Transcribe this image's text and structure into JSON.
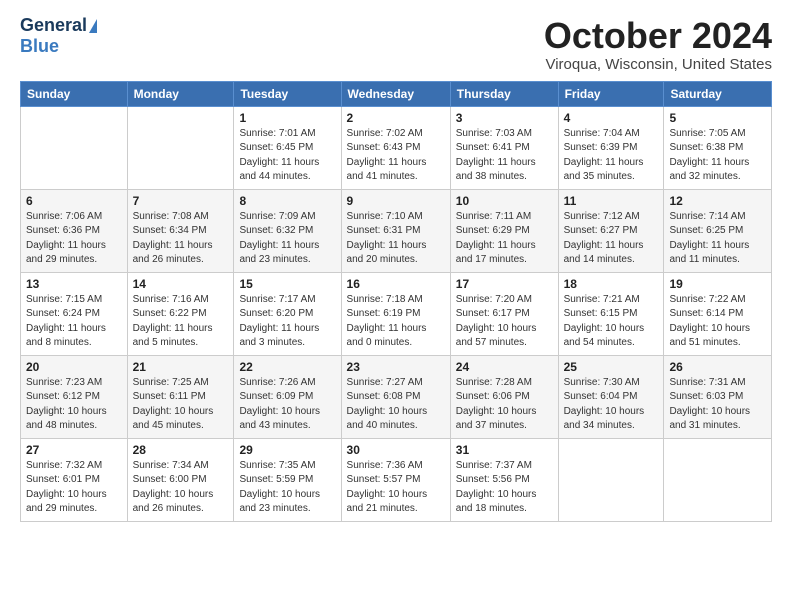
{
  "header": {
    "logo_line1": "General",
    "logo_line2": "Blue",
    "month_title": "October 2024",
    "location": "Viroqua, Wisconsin, United States"
  },
  "weekdays": [
    "Sunday",
    "Monday",
    "Tuesday",
    "Wednesday",
    "Thursday",
    "Friday",
    "Saturday"
  ],
  "weeks": [
    [
      {
        "day": "",
        "detail": ""
      },
      {
        "day": "",
        "detail": ""
      },
      {
        "day": "1",
        "detail": "Sunrise: 7:01 AM\nSunset: 6:45 PM\nDaylight: 11 hours\nand 44 minutes."
      },
      {
        "day": "2",
        "detail": "Sunrise: 7:02 AM\nSunset: 6:43 PM\nDaylight: 11 hours\nand 41 minutes."
      },
      {
        "day": "3",
        "detail": "Sunrise: 7:03 AM\nSunset: 6:41 PM\nDaylight: 11 hours\nand 38 minutes."
      },
      {
        "day": "4",
        "detail": "Sunrise: 7:04 AM\nSunset: 6:39 PM\nDaylight: 11 hours\nand 35 minutes."
      },
      {
        "day": "5",
        "detail": "Sunrise: 7:05 AM\nSunset: 6:38 PM\nDaylight: 11 hours\nand 32 minutes."
      }
    ],
    [
      {
        "day": "6",
        "detail": "Sunrise: 7:06 AM\nSunset: 6:36 PM\nDaylight: 11 hours\nand 29 minutes."
      },
      {
        "day": "7",
        "detail": "Sunrise: 7:08 AM\nSunset: 6:34 PM\nDaylight: 11 hours\nand 26 minutes."
      },
      {
        "day": "8",
        "detail": "Sunrise: 7:09 AM\nSunset: 6:32 PM\nDaylight: 11 hours\nand 23 minutes."
      },
      {
        "day": "9",
        "detail": "Sunrise: 7:10 AM\nSunset: 6:31 PM\nDaylight: 11 hours\nand 20 minutes."
      },
      {
        "day": "10",
        "detail": "Sunrise: 7:11 AM\nSunset: 6:29 PM\nDaylight: 11 hours\nand 17 minutes."
      },
      {
        "day": "11",
        "detail": "Sunrise: 7:12 AM\nSunset: 6:27 PM\nDaylight: 11 hours\nand 14 minutes."
      },
      {
        "day": "12",
        "detail": "Sunrise: 7:14 AM\nSunset: 6:25 PM\nDaylight: 11 hours\nand 11 minutes."
      }
    ],
    [
      {
        "day": "13",
        "detail": "Sunrise: 7:15 AM\nSunset: 6:24 PM\nDaylight: 11 hours\nand 8 minutes."
      },
      {
        "day": "14",
        "detail": "Sunrise: 7:16 AM\nSunset: 6:22 PM\nDaylight: 11 hours\nand 5 minutes."
      },
      {
        "day": "15",
        "detail": "Sunrise: 7:17 AM\nSunset: 6:20 PM\nDaylight: 11 hours\nand 3 minutes."
      },
      {
        "day": "16",
        "detail": "Sunrise: 7:18 AM\nSunset: 6:19 PM\nDaylight: 11 hours\nand 0 minutes."
      },
      {
        "day": "17",
        "detail": "Sunrise: 7:20 AM\nSunset: 6:17 PM\nDaylight: 10 hours\nand 57 minutes."
      },
      {
        "day": "18",
        "detail": "Sunrise: 7:21 AM\nSunset: 6:15 PM\nDaylight: 10 hours\nand 54 minutes."
      },
      {
        "day": "19",
        "detail": "Sunrise: 7:22 AM\nSunset: 6:14 PM\nDaylight: 10 hours\nand 51 minutes."
      }
    ],
    [
      {
        "day": "20",
        "detail": "Sunrise: 7:23 AM\nSunset: 6:12 PM\nDaylight: 10 hours\nand 48 minutes."
      },
      {
        "day": "21",
        "detail": "Sunrise: 7:25 AM\nSunset: 6:11 PM\nDaylight: 10 hours\nand 45 minutes."
      },
      {
        "day": "22",
        "detail": "Sunrise: 7:26 AM\nSunset: 6:09 PM\nDaylight: 10 hours\nand 43 minutes."
      },
      {
        "day": "23",
        "detail": "Sunrise: 7:27 AM\nSunset: 6:08 PM\nDaylight: 10 hours\nand 40 minutes."
      },
      {
        "day": "24",
        "detail": "Sunrise: 7:28 AM\nSunset: 6:06 PM\nDaylight: 10 hours\nand 37 minutes."
      },
      {
        "day": "25",
        "detail": "Sunrise: 7:30 AM\nSunset: 6:04 PM\nDaylight: 10 hours\nand 34 minutes."
      },
      {
        "day": "26",
        "detail": "Sunrise: 7:31 AM\nSunset: 6:03 PM\nDaylight: 10 hours\nand 31 minutes."
      }
    ],
    [
      {
        "day": "27",
        "detail": "Sunrise: 7:32 AM\nSunset: 6:01 PM\nDaylight: 10 hours\nand 29 minutes."
      },
      {
        "day": "28",
        "detail": "Sunrise: 7:34 AM\nSunset: 6:00 PM\nDaylight: 10 hours\nand 26 minutes."
      },
      {
        "day": "29",
        "detail": "Sunrise: 7:35 AM\nSunset: 5:59 PM\nDaylight: 10 hours\nand 23 minutes."
      },
      {
        "day": "30",
        "detail": "Sunrise: 7:36 AM\nSunset: 5:57 PM\nDaylight: 10 hours\nand 21 minutes."
      },
      {
        "day": "31",
        "detail": "Sunrise: 7:37 AM\nSunset: 5:56 PM\nDaylight: 10 hours\nand 18 minutes."
      },
      {
        "day": "",
        "detail": ""
      },
      {
        "day": "",
        "detail": ""
      }
    ]
  ]
}
